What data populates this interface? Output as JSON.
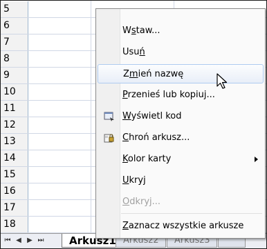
{
  "row_numbers": [
    "5",
    "6",
    "7",
    "8",
    "9",
    "10",
    "11",
    "12",
    "13",
    "14",
    "15",
    "16",
    "17",
    "18"
  ],
  "tabs": {
    "nav": [
      "⏮",
      "◀",
      "▶",
      "⏭"
    ],
    "sheets": [
      "Arkusz1",
      "Arkusz2",
      "Arkusz3"
    ],
    "active": "Arkusz1"
  },
  "menu": {
    "items": [
      {
        "pre": "W",
        "ul": "s",
        "post": "taw...",
        "icon": ""
      },
      {
        "pre": "Usu",
        "ul": "ń",
        "post": "",
        "icon": ""
      },
      {
        "pre": "Z",
        "ul": "m",
        "post": "ień nazwę",
        "icon": "",
        "state": "hover"
      },
      {
        "pre": "",
        "ul": "P",
        "post": "rzenieś lub kopiuj...",
        "icon": ""
      },
      {
        "pre": "",
        "ul": "W",
        "post": "yświetl kod",
        "icon": "view-code-icon"
      },
      {
        "pre": "",
        "ul": "C",
        "post": "hroń arkusz...",
        "icon": "protect-sheet-icon"
      },
      {
        "pre": "",
        "ul": "K",
        "post": "olor karty",
        "icon": "",
        "submenu": true
      },
      {
        "pre": "",
        "ul": "U",
        "post": "kryj",
        "icon": ""
      },
      {
        "pre": "",
        "ul": "O",
        "post": "dkryj...",
        "icon": "",
        "state": "disabled"
      },
      {
        "pre": "",
        "ul": "Z",
        "post": "aznacz wszystkie arkusze",
        "icon": ""
      }
    ]
  }
}
